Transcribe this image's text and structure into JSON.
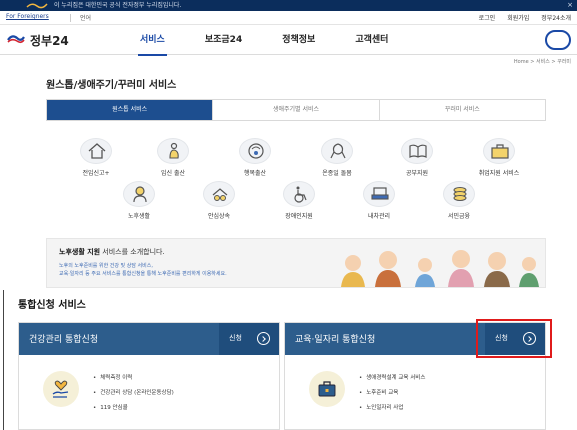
{
  "top_banner": {
    "text": "이 누리집은 대한민국 공식 전자정부 누리집입니다.",
    "close": "×"
  },
  "util_bar": {
    "for_foreigners": "For Foreigners",
    "language": "언어",
    "links": [
      "로그인",
      "회원가입",
      "정부24소개"
    ]
  },
  "header": {
    "logo_text": "정부24",
    "nav": [
      "서비스",
      "보조금24",
      "정책정보",
      "고객센터"
    ],
    "active_nav": "서비스"
  },
  "breadcrumb": "Home > 서비스 > 꾸러미",
  "page_title": "원스톱/생애주기/꾸러미 서비스",
  "tabs": [
    "원스톱 서비스",
    "생애주기별 서비스",
    "꾸러미 서비스"
  ],
  "icons": [
    {
      "label": "전입신고+",
      "icon": "house-icon"
    },
    {
      "label": "임신 출산",
      "icon": "pregnancy-icon"
    },
    {
      "label": "행복출산",
      "icon": "baby-icon"
    },
    {
      "label": "온종일 돌봄",
      "icon": "ribbon-icon"
    },
    {
      "label": "공부지원",
      "icon": "book-icon"
    },
    {
      "label": "취업지원 서비스",
      "icon": "briefcase-icon"
    },
    {
      "label": "노후생활",
      "icon": "elder-icon"
    },
    {
      "label": "안심상속",
      "icon": "inheritance-icon"
    },
    {
      "label": "장애인지원",
      "icon": "wheelchair-icon"
    },
    {
      "label": "내차관리",
      "icon": "car-icon"
    },
    {
      "label": "서민금융",
      "icon": "coins-icon"
    }
  ],
  "promo": {
    "title_bold": "노후생활 지원",
    "title_rest": " 서비스를 소개합니다.",
    "desc1": "노후의 노후준비를 위한 건강 및 상담 서비스,",
    "desc2": "교육·일자리 등 주요 서비스를 통합신청을 통해 노후준비를 편리하게 이용하세요."
  },
  "section_title": "통합신청 서비스",
  "cards": [
    {
      "title": "건강관리 통합신청",
      "apply": "신청",
      "icon": "heart-hand-icon",
      "items": [
        "체력측정 이력",
        "건강관리 상담 (온라인운동상담)",
        "119 안심콜"
      ]
    },
    {
      "title": "교육·일자리 통합신청",
      "apply": "신청",
      "icon": "briefcase-icon",
      "items": [
        "생애경력설계 교육 서비스",
        "노후준비 교육",
        "노인일자리 사업"
      ]
    }
  ],
  "colors": {
    "navy": "#0b2d5c",
    "brand_blue": "#1a49a6",
    "card_head": "#2d5d8c",
    "highlight": "#e01b1b"
  }
}
